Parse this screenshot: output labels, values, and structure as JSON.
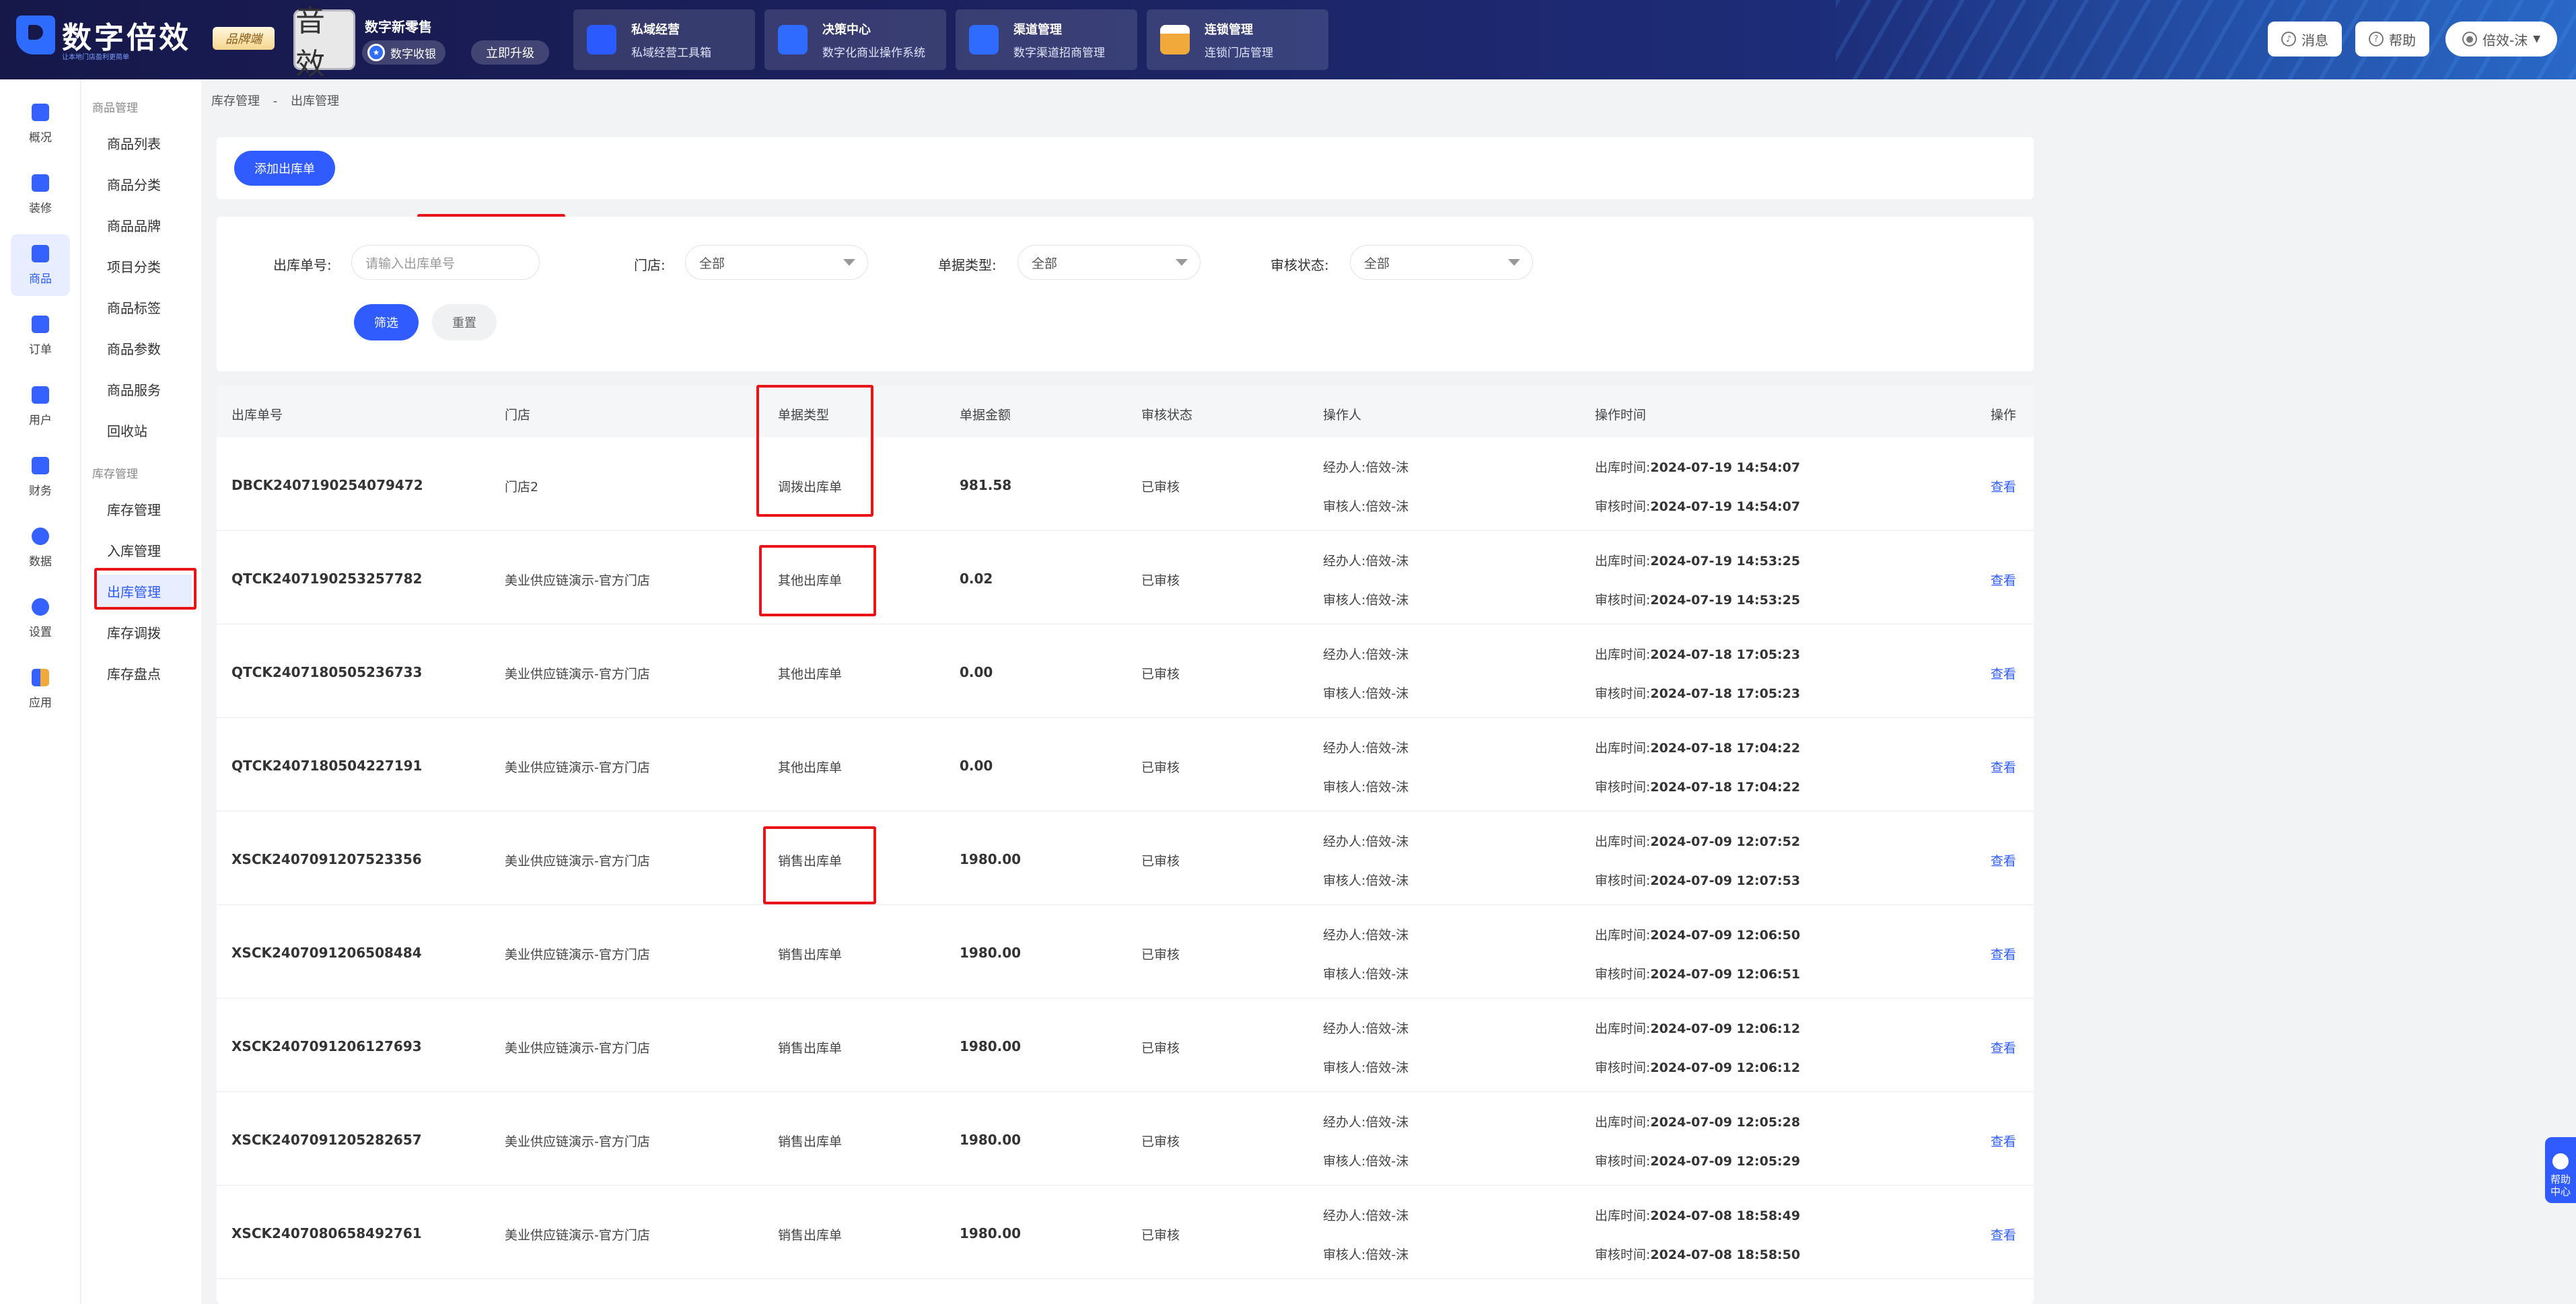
{
  "brand": {
    "name": "数字倍效",
    "slogan": "让本地门店盈利更简单",
    "tag": "品牌端"
  },
  "shop": {
    "avatar_text": "音效",
    "name": "数字新零售",
    "cashier": "数字收银",
    "upgrade": "立即升级"
  },
  "modules": [
    {
      "title": "私域经营",
      "sub": "私域经营工具箱",
      "color": "#3a6bff"
    },
    {
      "title": "决策中心",
      "sub": "数字化商业操作系统",
      "color": "#2f6bff"
    },
    {
      "title": "渠道管理",
      "sub": "数字渠道招商管理",
      "color": "#2f6bff"
    },
    {
      "title": "连锁管理",
      "sub": "连锁门店管理",
      "color": "#f2a93b"
    }
  ],
  "header_buttons": {
    "message": "消息",
    "help": "帮助",
    "user": "倍效-沫"
  },
  "leftnav": [
    "概况",
    "装修",
    "商品",
    "订单",
    "用户",
    "财务",
    "数据",
    "设置",
    "应用"
  ],
  "subnav": {
    "group1": "商品管理",
    "items1": [
      "商品列表",
      "商品分类",
      "商品品牌",
      "项目分类",
      "商品标签",
      "商品参数",
      "商品服务",
      "回收站"
    ],
    "group2": "库存管理",
    "items2": [
      "库存管理",
      "入库管理",
      "出库管理",
      "库存调拨",
      "库存盘点"
    ]
  },
  "breadcrumb": {
    "parent": "库存管理",
    "sep": "-",
    "current": "出库管理"
  },
  "add_button": "添加出库单",
  "filters": {
    "order_no_label": "出库单号:",
    "order_no_placeholder": "请输入出库单号",
    "store_label": "门店:",
    "store_value": "全部",
    "type_label": "单据类型:",
    "type_value": "全部",
    "status_label": "审核状态:",
    "status_value": "全部",
    "filter_btn": "筛选",
    "reset_btn": "重置"
  },
  "table": {
    "headers": [
      "出库单号",
      "门店",
      "单据类型",
      "单据金额",
      "审核状态",
      "操作人",
      "操作时间",
      "操作"
    ],
    "handler_prefix": "经办人:",
    "auditor_prefix": "审核人:",
    "out_time_prefix": "出库时间:",
    "audit_time_prefix": "审核时间:",
    "rows": [
      {
        "no": "DBCK2407190254079472",
        "store": "门店2",
        "type": "调拨出库单",
        "amount": "981.58",
        "status": "已审核",
        "handler": "倍效-沫",
        "auditor": "倍效-沫",
        "out_time": "2024-07-19 14:54:07",
        "audit_time": "2024-07-19 14:54:07",
        "action": "查看"
      },
      {
        "no": "QTCK2407190253257782",
        "store": "美业供应链演示-官方门店",
        "type": "其他出库单",
        "amount": "0.02",
        "status": "已审核",
        "handler": "倍效-沫",
        "auditor": "倍效-沫",
        "out_time": "2024-07-19 14:53:25",
        "audit_time": "2024-07-19 14:53:25",
        "action": "查看"
      },
      {
        "no": "QTCK2407180505236733",
        "store": "美业供应链演示-官方门店",
        "type": "其他出库单",
        "amount": "0.00",
        "status": "已审核",
        "handler": "倍效-沫",
        "auditor": "倍效-沫",
        "out_time": "2024-07-18 17:05:23",
        "audit_time": "2024-07-18 17:05:23",
        "action": "查看"
      },
      {
        "no": "QTCK2407180504227191",
        "store": "美业供应链演示-官方门店",
        "type": "其他出库单",
        "amount": "0.00",
        "status": "已审核",
        "handler": "倍效-沫",
        "auditor": "倍效-沫",
        "out_time": "2024-07-18 17:04:22",
        "audit_time": "2024-07-18 17:04:22",
        "action": "查看"
      },
      {
        "no": "XSCK2407091207523356",
        "store": "美业供应链演示-官方门店",
        "type": "销售出库单",
        "amount": "1980.00",
        "status": "已审核",
        "handler": "倍效-沫",
        "auditor": "倍效-沫",
        "out_time": "2024-07-09 12:07:52",
        "audit_time": "2024-07-09 12:07:53",
        "action": "查看"
      },
      {
        "no": "XSCK2407091206508484",
        "store": "美业供应链演示-官方门店",
        "type": "销售出库单",
        "amount": "1980.00",
        "status": "已审核",
        "handler": "倍效-沫",
        "auditor": "倍效-沫",
        "out_time": "2024-07-09 12:06:50",
        "audit_time": "2024-07-09 12:06:51",
        "action": "查看"
      },
      {
        "no": "XSCK2407091206127693",
        "store": "美业供应链演示-官方门店",
        "type": "销售出库单",
        "amount": "1980.00",
        "status": "已审核",
        "handler": "倍效-沫",
        "auditor": "倍效-沫",
        "out_time": "2024-07-09 12:06:12",
        "audit_time": "2024-07-09 12:06:12",
        "action": "查看"
      },
      {
        "no": "XSCK2407091205282657",
        "store": "美业供应链演示-官方门店",
        "type": "销售出库单",
        "amount": "1980.00",
        "status": "已审核",
        "handler": "倍效-沫",
        "auditor": "倍效-沫",
        "out_time": "2024-07-09 12:05:28",
        "audit_time": "2024-07-09 12:05:29",
        "action": "查看"
      },
      {
        "no": "XSCK2407080658492761",
        "store": "美业供应链演示-官方门店",
        "type": "销售出库单",
        "amount": "1980.00",
        "status": "已审核",
        "handler": "倍效-沫",
        "auditor": "倍效-沫",
        "out_time": "2024-07-08 18:58:49",
        "audit_time": "2024-07-08 18:58:50",
        "action": "查看"
      }
    ]
  },
  "help_widget": "帮助中心"
}
